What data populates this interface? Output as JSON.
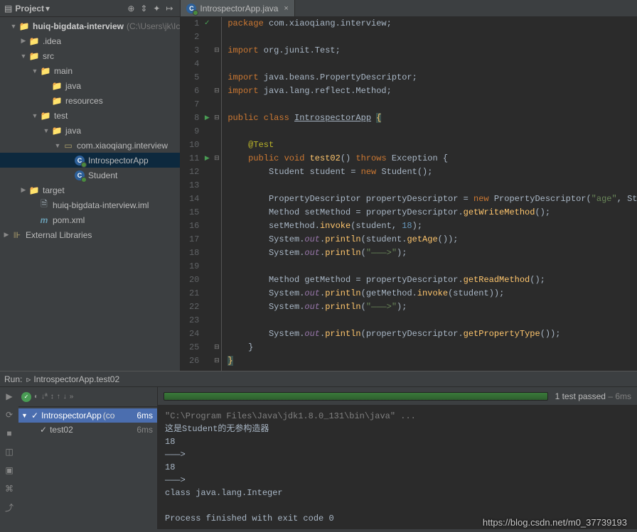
{
  "sidebar": {
    "title": "Project",
    "nodes": [
      {
        "pad": 14,
        "arrow": "▼",
        "iconType": "folder",
        "label": "huiq-bigdata-interview",
        "suffix": " (C:\\Users\\jk\\Ic",
        "bold": true
      },
      {
        "pad": 28,
        "arrow": "▶",
        "iconType": "folder",
        "label": ".idea"
      },
      {
        "pad": 28,
        "arrow": "▼",
        "iconType": "src-folder",
        "label": "src"
      },
      {
        "pad": 44,
        "arrow": "▼",
        "iconType": "folder",
        "label": "main"
      },
      {
        "pad": 60,
        "arrow": "",
        "iconType": "src-folder",
        "label": "java"
      },
      {
        "pad": 60,
        "arrow": "",
        "iconType": "folder",
        "label": "resources"
      },
      {
        "pad": 44,
        "arrow": "▼",
        "iconType": "folder",
        "label": "test"
      },
      {
        "pad": 60,
        "arrow": "▼",
        "iconType": "src-folder",
        "label": "java"
      },
      {
        "pad": 76,
        "arrow": "▼",
        "iconType": "pkg",
        "label": "com.xiaoqiang.interview"
      },
      {
        "pad": 92,
        "arrow": "",
        "iconType": "class",
        "label": "IntrospectorApp",
        "selected": true
      },
      {
        "pad": 92,
        "arrow": "",
        "iconType": "class",
        "label": "Student"
      },
      {
        "pad": 28,
        "arrow": "▶",
        "iconType": "folder",
        "label": "target"
      },
      {
        "pad": 42,
        "arrow": "",
        "iconType": "file",
        "label": "huiq-bigdata-interview.iml"
      },
      {
        "pad": 42,
        "arrow": "",
        "iconType": "file-m",
        "label": "pom.xml"
      },
      {
        "pad": 4,
        "arrow": "▶",
        "iconType": "lib",
        "label": "External Libraries"
      }
    ]
  },
  "tab": {
    "label": "IntrospectorApp.java"
  },
  "code": {
    "lines": [
      {
        "n": 1,
        "marker": "check",
        "fold": "",
        "html": "<span class='kw'>package</span> <span class='pkg-path'>com.xiaoqiang.interview</span><span class='punct'>;</span>"
      },
      {
        "n": 2,
        "marker": "",
        "fold": "",
        "html": ""
      },
      {
        "n": 3,
        "marker": "",
        "fold": "⊟",
        "html": "<span class='kw'>import</span> <span class='pkg-path'>org.junit.</span><span class='cls'>Test</span><span class='punct'>;</span>"
      },
      {
        "n": 4,
        "marker": "",
        "fold": "",
        "html": ""
      },
      {
        "n": 5,
        "marker": "",
        "fold": "",
        "html": "<span class='kw'>import</span> <span class='pkg-path'>java.beans.</span><span class='cls'>PropertyDescriptor</span><span class='punct'>;</span>"
      },
      {
        "n": 6,
        "marker": "",
        "fold": "⊟",
        "html": "<span class='kw'>import</span> <span class='pkg-path'>java.lang.reflect.</span><span class='cls'>Method</span><span class='punct'>;</span>"
      },
      {
        "n": 7,
        "marker": "",
        "fold": "",
        "html": ""
      },
      {
        "n": 8,
        "marker": "arrow-run",
        "fold": "⊟",
        "html": "<span class='kw'>public</span> <span class='kw'>class</span> <span class='cls underline'>IntrospectorApp</span> <span class='caret-brace'>{</span>"
      },
      {
        "n": 9,
        "marker": "",
        "fold": "",
        "html": ""
      },
      {
        "n": 10,
        "marker": "",
        "fold": "",
        "html": "    <span class='ann'>@Test</span>"
      },
      {
        "n": 11,
        "marker": "arrow-run",
        "fold": "⊟",
        "html": "    <span class='kw'>public</span> <span class='kw'>void</span> <span class='fn'>test02</span><span class='punct'>()</span> <span class='kw'>throws</span> <span class='cls'>Exception</span> <span class='punct'>{</span>"
      },
      {
        "n": 12,
        "marker": "",
        "fold": "",
        "html": "        <span class='cls'>Student</span> <span class='pkg-path'>student</span> <span class='punct'>=</span> <span class='kw'>new</span> <span class='cls'>Student</span><span class='punct'>();</span>"
      },
      {
        "n": 13,
        "marker": "",
        "fold": "",
        "html": ""
      },
      {
        "n": 14,
        "marker": "",
        "fold": "",
        "html": "        <span class='cls'>PropertyDescriptor</span> <span class='pkg-path'>propertyDescriptor</span> <span class='punct'>=</span> <span class='kw'>new</span> <span class='cls'>PropertyDescriptor</span><span class='punct'>(</span><span class='str'>\"age\"</span><span class='punct'>,</span> <span class='cls'>Student</span><span class='punct'>.</span><span class='kw'>class</span><span class='punct'>);</span>"
      },
      {
        "n": 15,
        "marker": "",
        "fold": "",
        "html": "        <span class='cls'>Method</span> <span class='pkg-path'>setMethod</span> <span class='punct'>=</span> <span class='pkg-path'>propertyDescriptor</span><span class='punct'>.</span><span class='fn'>getWriteMethod</span><span class='punct'>();</span>"
      },
      {
        "n": 16,
        "marker": "",
        "fold": "",
        "html": "        <span class='pkg-path'>setMethod</span><span class='punct'>.</span><span class='fn'>invoke</span><span class='punct'>(</span><span class='pkg-path'>student</span><span class='punct'>,</span> <span class='num'>18</span><span class='punct'>);</span>"
      },
      {
        "n": 17,
        "marker": "",
        "fold": "",
        "html": "        <span class='cls'>System</span><span class='punct'>.</span><span class='field'>out</span><span class='punct'>.</span><span class='fn'>println</span><span class='punct'>(</span><span class='pkg-path'>student</span><span class='punct'>.</span><span class='fn'>getAge</span><span class='punct'>());</span>"
      },
      {
        "n": 18,
        "marker": "",
        "fold": "",
        "html": "        <span class='cls'>System</span><span class='punct'>.</span><span class='field'>out</span><span class='punct'>.</span><span class='fn'>println</span><span class='punct'>(</span><span class='str'>\"———&gt;\"</span><span class='punct'>);</span>"
      },
      {
        "n": 19,
        "marker": "",
        "fold": "",
        "html": ""
      },
      {
        "n": 20,
        "marker": "",
        "fold": "",
        "html": "        <span class='cls'>Method</span> <span class='pkg-path'>getMethod</span> <span class='punct'>=</span> <span class='pkg-path'>propertyDescriptor</span><span class='punct'>.</span><span class='fn'>getReadMethod</span><span class='punct'>();</span>"
      },
      {
        "n": 21,
        "marker": "",
        "fold": "",
        "html": "        <span class='cls'>System</span><span class='punct'>.</span><span class='field'>out</span><span class='punct'>.</span><span class='fn'>println</span><span class='punct'>(</span><span class='pkg-path'>getMethod</span><span class='punct'>.</span><span class='fn'>invoke</span><span class='punct'>(</span><span class='pkg-path'>student</span><span class='punct'>));</span>"
      },
      {
        "n": 22,
        "marker": "",
        "fold": "",
        "html": "        <span class='cls'>System</span><span class='punct'>.</span><span class='field'>out</span><span class='punct'>.</span><span class='fn'>println</span><span class='punct'>(</span><span class='str'>\"———&gt;\"</span><span class='punct'>);</span>"
      },
      {
        "n": 23,
        "marker": "",
        "fold": "",
        "html": ""
      },
      {
        "n": 24,
        "marker": "",
        "fold": "",
        "html": "        <span class='cls'>System</span><span class='punct'>.</span><span class='field'>out</span><span class='punct'>.</span><span class='fn'>println</span><span class='punct'>(</span><span class='pkg-path'>propertyDescriptor</span><span class='punct'>.</span><span class='fn'>getPropertyType</span><span class='punct'>());</span>"
      },
      {
        "n": 25,
        "marker": "",
        "fold": "⊟",
        "html": "    <span class='punct'>}</span>"
      },
      {
        "n": 26,
        "marker": "",
        "fold": "⊟",
        "html": "<span class='caret-brace'>}</span>"
      }
    ]
  },
  "run": {
    "headerTitle": "Run:",
    "headerTarget": "IntrospectorApp.test02",
    "testStatus": "1 test passed",
    "testTime": "– 6ms",
    "root": {
      "label": "IntrospectorApp",
      "suffix": "(co",
      "time": "6ms"
    },
    "child": {
      "label": "test02",
      "time": "6ms"
    },
    "console": "\"C:\\Program Files\\Java\\jdk1.8.0_131\\bin\\java\" ...\n这是Student的无参构造器\n18\n———>\n18\n———>\nclass java.lang.Integer\n\nProcess finished with exit code 0"
  },
  "watermark": "https://blog.csdn.net/m0_37739193"
}
